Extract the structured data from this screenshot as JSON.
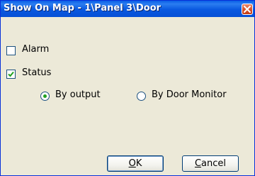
{
  "window": {
    "title": "Show On Map - 1\\Panel 3\\Door"
  },
  "options": {
    "alarm": {
      "label": "Alarm",
      "checked": false
    },
    "status": {
      "label": "Status",
      "checked": true
    },
    "by_output": {
      "label": "By output",
      "selected": true
    },
    "by_door_monitor": {
      "label": "By Door  Monitor",
      "selected": false
    }
  },
  "buttons": {
    "ok_mnemonic": "O",
    "ok_rest": "K",
    "cancel_mnemonic": "C",
    "cancel_rest": "ancel"
  },
  "colors": {
    "title_bar": "#0a5fe6",
    "dialog_bg": "#ece9d8",
    "check_mark": "#21a121",
    "close_button": "#d9532b"
  },
  "icons": [
    "close-icon",
    "check-icon",
    "radio-dot"
  ]
}
